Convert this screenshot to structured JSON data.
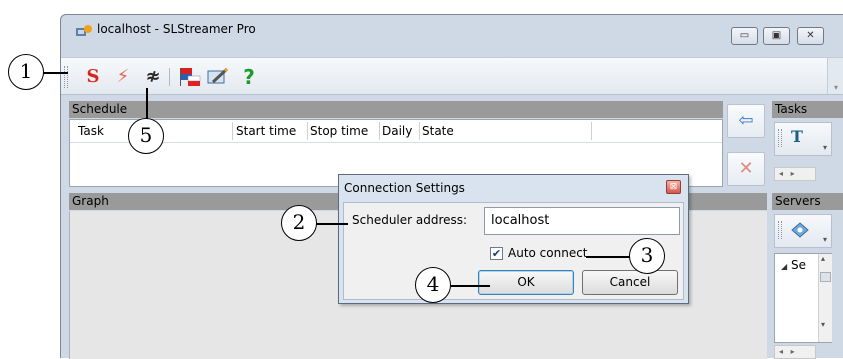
{
  "window": {
    "title": "localhost - SLStreamer Pro",
    "controls": {
      "minimize": "▭",
      "maximize": "▣",
      "close": "✕"
    }
  },
  "toolbar": {
    "icons": [
      {
        "name": "start-s-icon",
        "glyph": "S",
        "color": "#d9251c"
      },
      {
        "name": "lightning-icon",
        "glyph": "⚡",
        "color": "#e36a57"
      },
      {
        "name": "signal-wave-icon",
        "glyph": "≉",
        "color": "#2a2a2a"
      },
      {
        "name": "flags-icon",
        "glyph": "▤",
        "color": "#2a5fb4"
      },
      {
        "name": "edit-card-icon",
        "glyph": "✎",
        "color": "#3d6e9e"
      },
      {
        "name": "help-icon",
        "glyph": "?",
        "color": "#1c9b2c"
      }
    ]
  },
  "schedule": {
    "header": "Schedule",
    "columns": [
      "Task",
      "Start time",
      "Stop time",
      "Daily",
      "State"
    ]
  },
  "graph": {
    "header": "Graph"
  },
  "side_buttons": {
    "back": "⇦",
    "delete": "✕"
  },
  "tasks": {
    "header": "Tasks",
    "tool_glyph": "T"
  },
  "servers": {
    "header": "Servers",
    "tree_item": "Se",
    "tree_arrow": "◢"
  },
  "scroll": {
    "left": "◂",
    "right": "▸",
    "up": "▴",
    "down": "▾"
  },
  "dialog": {
    "title": "Connection Settings",
    "close": "⊠",
    "address_label": "Scheduler address:",
    "address_value": "localhost",
    "auto_connect_label": "Auto connect",
    "auto_connect_checked": true,
    "check_mark": "✔",
    "ok": "OK",
    "cancel": "Cancel"
  },
  "callouts": [
    "1",
    "2",
    "3",
    "4",
    "5"
  ]
}
